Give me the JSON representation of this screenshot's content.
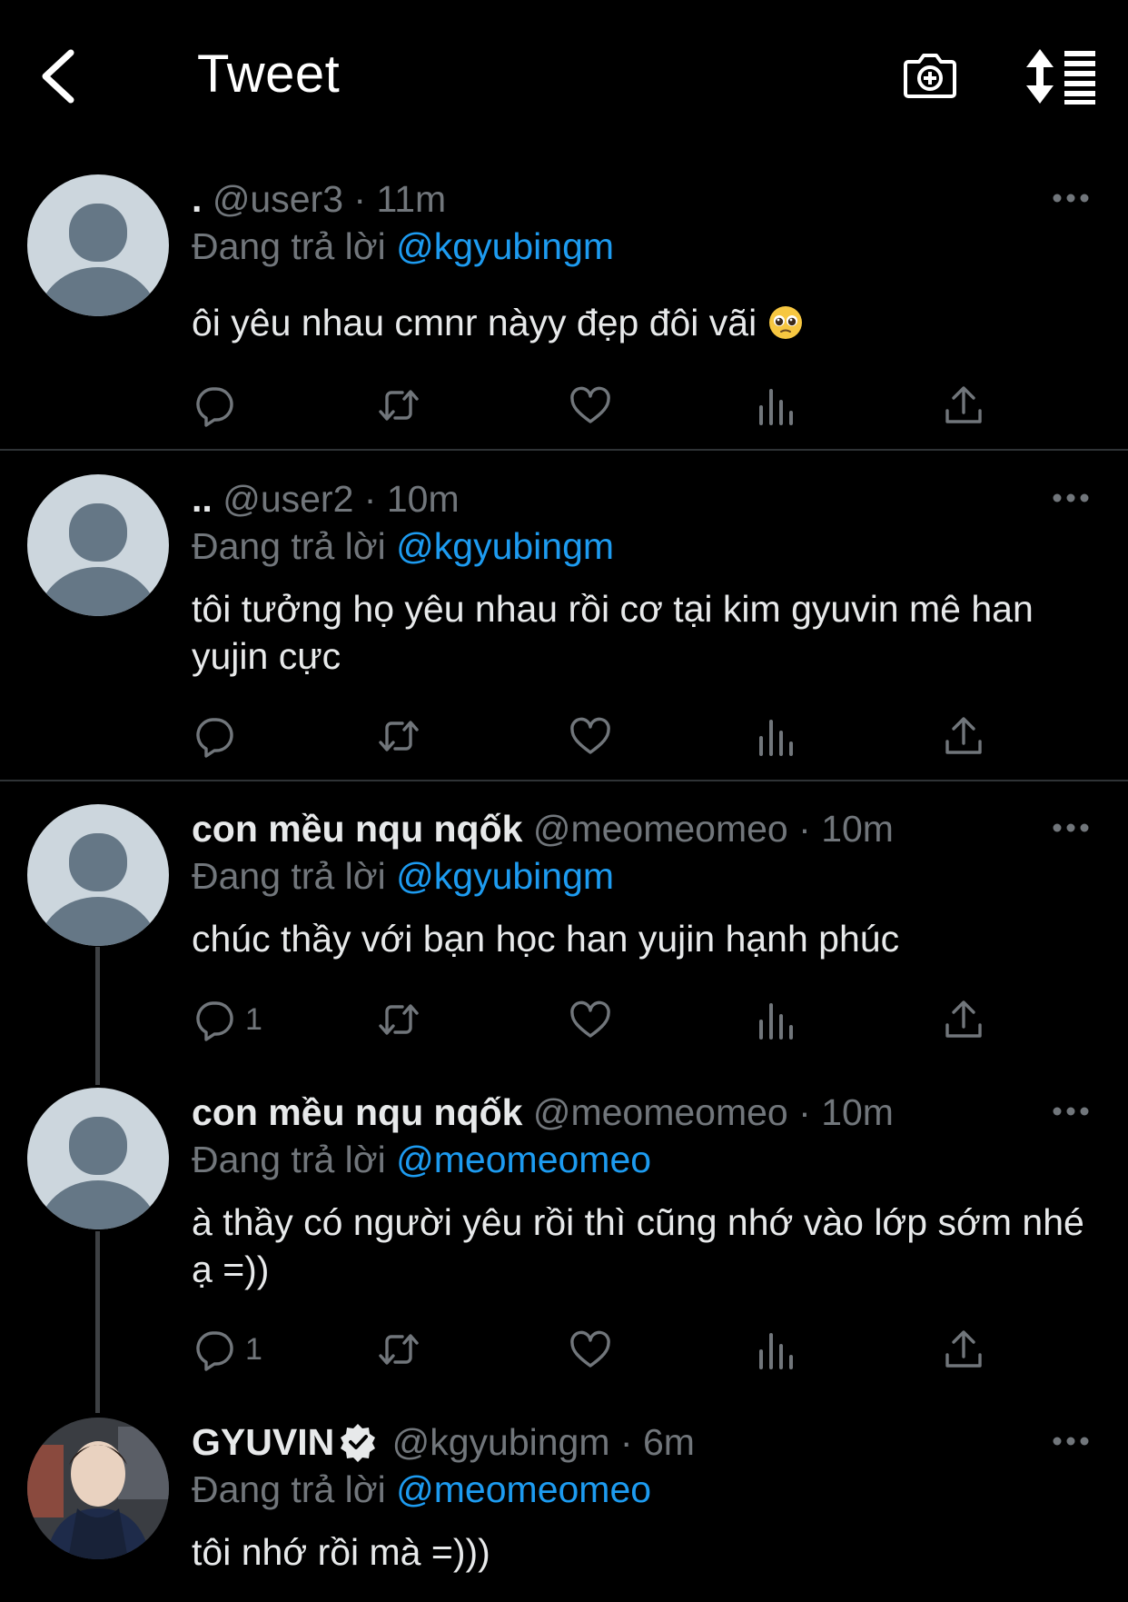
{
  "header": {
    "title": "Tweet"
  },
  "tweets": [
    {
      "display_name": ".",
      "handle": "@user3",
      "time": "· 11m",
      "replying_to_label": "Đang trả lời",
      "replying_to": "@kgyubingm",
      "text": "ôi yêu nhau cmnr nàyy đẹp đôi vãi",
      "reply_count": ""
    },
    {
      "display_name": "..",
      "handle": "@user2",
      "time": "· 10m",
      "replying_to_label": "Đang trả lời",
      "replying_to": "@kgyubingm",
      "text": "tôi tưởng họ yêu nhau rồi cơ tại kim gyuvin mê han yujin cực",
      "reply_count": ""
    },
    {
      "display_name": "con mều nqu nqốk",
      "handle": "@meomeomeo",
      "time": "· 10m",
      "replying_to_label": "Đang trả lời",
      "replying_to": "@kgyubingm",
      "text": "chúc thầy với bạn học han yujin hạnh phúc",
      "reply_count": "1"
    },
    {
      "display_name": "con mều nqu nqốk",
      "handle": "@meomeomeo",
      "time": "· 10m",
      "replying_to_label": "Đang trả lời",
      "replying_to": "@meomeomeo",
      "text": "à thầy có người yêu rồi thì cũng nhớ vào lớp sớm nhé ạ =))",
      "reply_count": "1"
    },
    {
      "display_name": "GYUVIN",
      "handle": "@kgyubingm",
      "time": "· 6m",
      "replying_to_label": "Đang trả lời",
      "replying_to": "@meomeomeo",
      "text": "tôi nhớ rồi mà =)))",
      "verified": true
    }
  ],
  "colors": {
    "background": "#000000",
    "text": "#e7e9ea",
    "secondary": "#71767b",
    "link": "#1d9bf0",
    "divider": "#2f3336"
  },
  "icons": {
    "back": "chevron-left-icon",
    "camera": "camera-plus-icon",
    "sort": "sort-icon",
    "reply": "reply-icon",
    "retweet": "retweet-icon",
    "like": "heart-icon",
    "views": "views-icon",
    "share": "share-icon",
    "more": "more-icon",
    "emoji": "pleading-face-emoji-icon"
  }
}
